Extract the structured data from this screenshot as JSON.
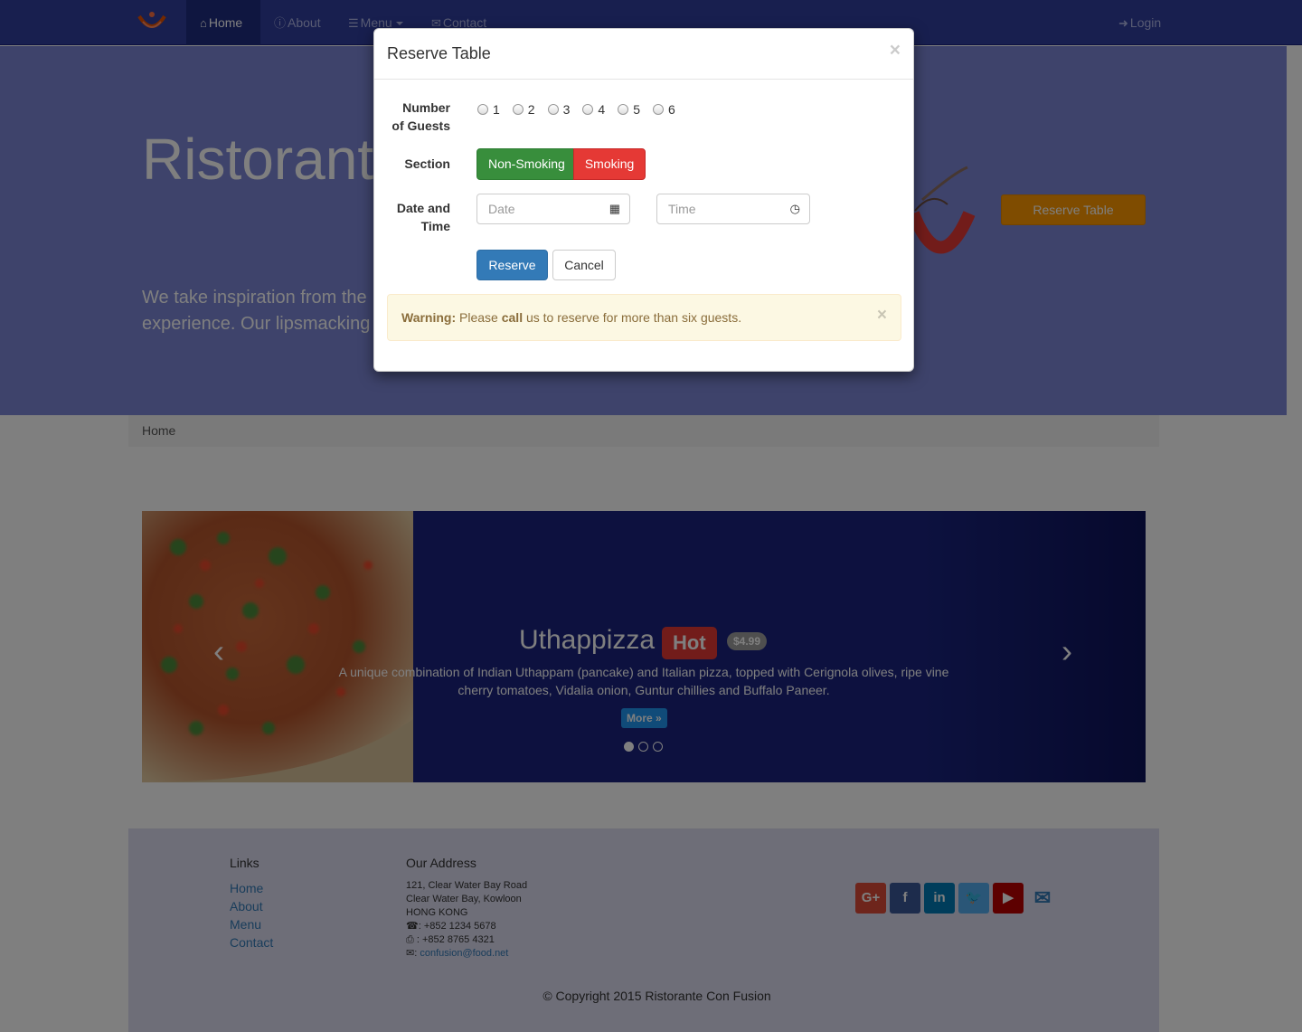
{
  "navbar": {
    "brand_logo": "logo-icon",
    "items": [
      {
        "label": "Home",
        "icon": "home-icon",
        "active": true
      },
      {
        "label": "About",
        "icon": "info-icon",
        "active": false
      },
      {
        "label": "Menu",
        "icon": "list-icon",
        "active": false,
        "dropdown": true
      },
      {
        "label": "Contact",
        "icon": "envelope-icon",
        "active": false
      }
    ],
    "login_label": "Login",
    "login_icon": "login-icon"
  },
  "jumbotron": {
    "title": "Ristorante",
    "text_line1": "We take inspiration from the",
    "text_line2": "experience. Our lipsmacking",
    "reserve_button": "Reserve Table"
  },
  "breadcrumb": {
    "current": "Home"
  },
  "carousel": {
    "title": "Uthappizza",
    "badge": "Hot",
    "price": "$4.99",
    "description": "A unique combination of Indian Uthappam (pancake) and Italian pizza, topped with Cerignola olives, ripe vine cherry tomatoes, Vidalia onion, Guntur chillies and Buffalo Paneer.",
    "more_button": "More »",
    "slides": 3,
    "active_slide": 1
  },
  "footer": {
    "links_heading": "Links",
    "links": [
      "Home",
      "About",
      "Menu",
      "Contact"
    ],
    "address_heading": "Our Address",
    "address_line1": "121, Clear Water Bay Road",
    "address_line2": "Clear Water Bay, Kowloon",
    "address_line3": "HONG KONG",
    "phone": ": +852 1234 5678",
    "fax": ": +852 8765 4321",
    "email": "confusion@food.net",
    "social": [
      "google-plus-icon",
      "facebook-icon",
      "linkedin-icon",
      "twitter-icon",
      "youtube-icon",
      "mail-icon"
    ],
    "copyright": "© Copyright 2015 Ristorante Con Fusion"
  },
  "modal": {
    "title": "Reserve Table",
    "close": "×",
    "guests_label_1": "Number",
    "guests_label_2": "of Guests",
    "guest_options": [
      "1",
      "2",
      "3",
      "4",
      "5",
      "6"
    ],
    "section_label": "Section",
    "section_options": [
      "Non-Smoking",
      "Smoking"
    ],
    "datetime_label_1": "Date and",
    "datetime_label_2": "Time",
    "date_placeholder": "Date",
    "time_placeholder": "Time",
    "reserve_button": "Reserve",
    "cancel_button": "Cancel",
    "warning_strong": "Warning:",
    "warning_pre": " Please ",
    "warning_call": "call",
    "warning_post": " us to reserve for more than six guests.",
    "warning_close": "×"
  },
  "colors": {
    "navbar": "#303f9f",
    "jumbotron": "#7d86d6",
    "accent": "#ff9800",
    "non_smoking": "#388e3c",
    "smoking": "#e53935",
    "primary": "#337ab7",
    "warning_bg": "#fcf8e3"
  }
}
